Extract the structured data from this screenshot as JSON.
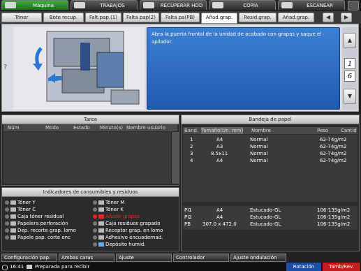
{
  "top_tabs": [
    {
      "label": "Máquina",
      "active": true
    },
    {
      "label": "TRABAJOS",
      "active": false
    },
    {
      "label": "RECUPERAR HDD",
      "active": false
    },
    {
      "label": "COPIA",
      "active": false
    },
    {
      "label": "ESCANEAR",
      "active": false
    }
  ],
  "sub_tabs": [
    "Tóner",
    "Bote recup.",
    "Falt.pap.(1)",
    "Falta pap(2)",
    "Falta pa(PB)",
    "Añad.grap.",
    "Resid.grap.",
    "Añad.grap."
  ],
  "sub_tab_selected": "Añad.grap.",
  "message": "Abra la puerta frontal de la unidad de acabado con grapas y saque el apilador.",
  "help_label": "?",
  "pager": {
    "current": "1",
    "total": "6",
    "up": "▲",
    "down": "▼"
  },
  "nav_arrows": {
    "left": "◀",
    "right": "▶"
  },
  "task_panel": {
    "title": "Tarea",
    "columns": [
      "Núm",
      "Modo",
      "Estado",
      "Minuto(s)",
      "Nombre usuario"
    ]
  },
  "tray_panel": {
    "title": "Bandeja de papel",
    "columns": [
      "Band.",
      "Tamaño(Un. mm)",
      "Nombre",
      "Peso",
      "Cantid"
    ],
    "rows": [
      {
        "tray": "1",
        "size": "A4",
        "name": "Normal",
        "weight": "62-74g/m2"
      },
      {
        "tray": "2",
        "size": "A3",
        "name": "Normal",
        "weight": "62-74g/m2"
      },
      {
        "tray": "3",
        "size": "8.5x11",
        "name": "Normal",
        "weight": "62-74g/m2"
      },
      {
        "tray": "4",
        "size": "A4",
        "name": "Normal",
        "weight": "62-74g/m2"
      }
    ],
    "rows_lower": [
      {
        "tray": "PI1",
        "size": "A4",
        "name": "Estucado-GL",
        "weight": "106-135g/m2"
      },
      {
        "tray": "PI2",
        "size": "A4",
        "name": "Estucado-GL",
        "weight": "106-135g/m2"
      },
      {
        "tray": "PB",
        "size": "307.0 x 472.0",
        "name": "Estucado-GL",
        "weight": "106-135g/m2"
      }
    ]
  },
  "consumables_panel": {
    "title": "Indicadores de consumibles y residuos",
    "left": [
      "Tóner Y",
      "Tóner C",
      "Caja tóner residual",
      "Papelera perforación",
      "Dep. recorte grap. lomo",
      "Papele pap. corte enc"
    ],
    "right": [
      "Tóner M",
      "Tóner K",
      "Añadir grapas",
      "Caja residuos grapado",
      "Receptor grap. en lomo",
      "Adhesivo encuadernad.",
      "Depósito humid."
    ],
    "alert_item": "Añadir grapas"
  },
  "bottom_buttons": [
    "Configuración pap.",
    "Ambas caras",
    "Ajuste",
    "Controlador",
    "Ajuste ondulación"
  ],
  "status": {
    "time": "16:41",
    "message": "Preparada para recibir",
    "rotation": "Rotación",
    "front_back": "Tamb/Rev."
  },
  "colors": {
    "active_tab": "#2f8f2f",
    "message_bg": "#2d6cc4",
    "alert": "#e22222"
  }
}
